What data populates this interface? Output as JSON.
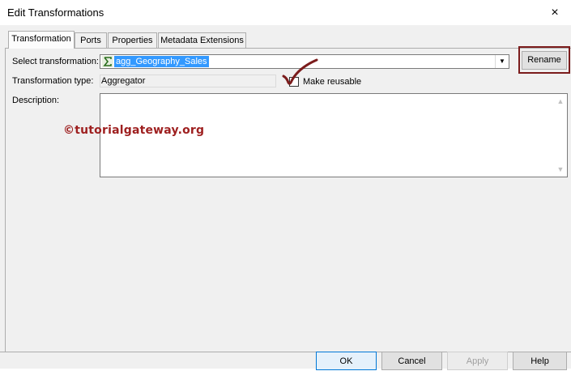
{
  "window": {
    "title": "Edit Transformations",
    "close_label": "×"
  },
  "tabs": [
    {
      "label": "Transformation",
      "active": true
    },
    {
      "label": "Ports",
      "active": false
    },
    {
      "label": "Properties",
      "active": false
    },
    {
      "label": "Metadata Extensions",
      "active": false
    }
  ],
  "form": {
    "select_label": "Select transformation:",
    "select_value": "agg_Geography_Sales",
    "select_icon": "aggregator-sigma-icon",
    "rename_label": "Rename",
    "type_label": "Transformation type:",
    "type_value": "Aggregator",
    "reusable_label": "Make reusable",
    "reusable_checked": false,
    "description_label": "Description:",
    "description_value": ""
  },
  "watermark": "©tutorialgateway.org",
  "buttons": {
    "ok": "OK",
    "cancel": "Cancel",
    "apply": "Apply",
    "help": "Help"
  },
  "colors": {
    "highlight": "#3399ff",
    "annotation": "#7b1c1c"
  }
}
